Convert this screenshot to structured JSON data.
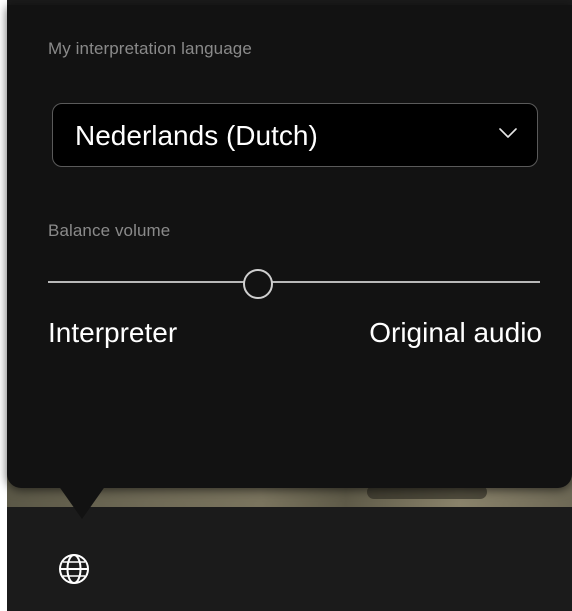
{
  "language_section": {
    "label": "My interpretation language",
    "selected_language": "Nederlands (Dutch)",
    "dropdown_icon": "chevron-down-icon"
  },
  "balance_section": {
    "label": "Balance volume",
    "slider_value_fraction": 0.425,
    "left_label": "Interpreter",
    "right_label": "Original audio"
  },
  "toolbar": {
    "language_icon": "globe-icon"
  },
  "colors": {
    "panel": "#121212",
    "text": "#ffffff",
    "muted_text": "#8a8a8a",
    "track": "#b8b8b8"
  }
}
